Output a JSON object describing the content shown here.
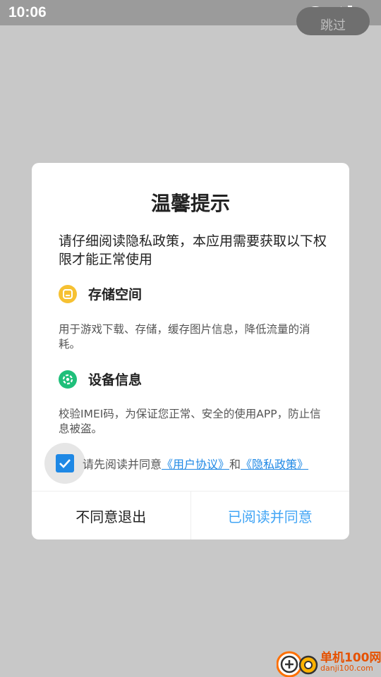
{
  "status_bar": {
    "time": "10:06",
    "skip_label": "跳过"
  },
  "dialog": {
    "title": "温馨提示",
    "intro": "请仔细阅读隐私政策，本应用需要获取以下权限才能正常使用",
    "permissions": [
      {
        "title": "存储空间",
        "description": "用于游戏下载、存储，缓存图片信息，降低流量的消耗。",
        "icon": "storage-icon",
        "color": "#f6c132"
      },
      {
        "title": "设备信息",
        "description": "校验IMEI码，为保证您正常、安全的使用APP，防止信息被盗。",
        "icon": "device-settings-icon",
        "color": "#1fbf7a"
      }
    ],
    "consent": {
      "checked": true,
      "prefix": "请先阅读并同意",
      "user_agreement": "《用户协议》",
      "and": "和",
      "privacy_policy": "《隐私政策》"
    },
    "buttons": {
      "disagree": "不同意退出",
      "agree": "已阅读并同意"
    }
  },
  "watermark": {
    "name": "单机100网",
    "url": "danji100.com"
  },
  "colors": {
    "accent": "#1e88e5",
    "agree_text": "#42a5f5",
    "overlay": "#c8c8c8"
  }
}
